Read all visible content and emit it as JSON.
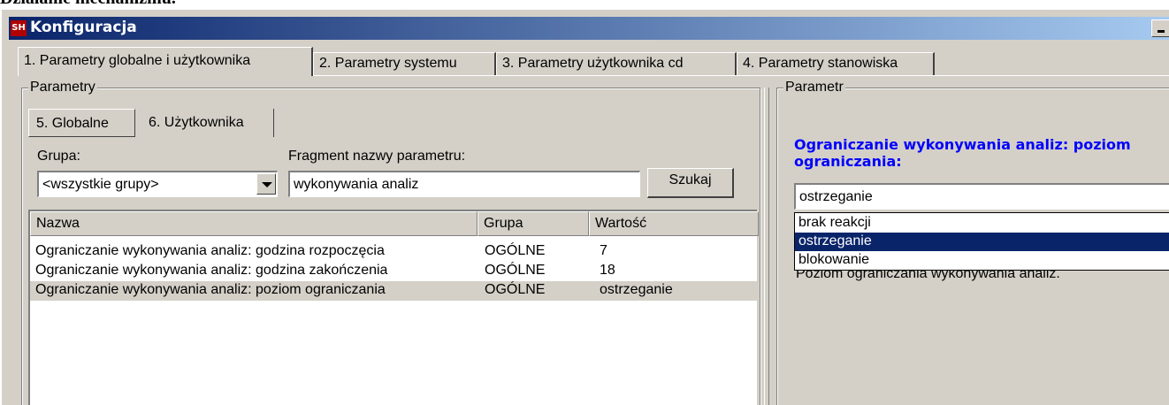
{
  "document": {
    "heading": "Działanie mechanizmu."
  },
  "window": {
    "title": "Konfiguracja",
    "icon_text": "SH"
  },
  "tabs": [
    {
      "label": "1. Parametry globalne i użytkownika"
    },
    {
      "label": "2. Parametry systemu"
    },
    {
      "label": "3. Parametry użytkownika cd"
    },
    {
      "label": "4. Parametry stanowiska"
    }
  ],
  "left_panel": {
    "group_label": "Parametry",
    "subtabs": [
      {
        "label": "5. Globalne"
      },
      {
        "label": "6. Użytkownika"
      }
    ],
    "group_field_label": "Grupa:",
    "group_value": "<wszystkie grupy>",
    "fragment_label": "Fragment nazwy parametru:",
    "fragment_value": "wykonywania analiz",
    "search_button": "Szukaj",
    "table": {
      "columns": [
        "Nazwa",
        "Grupa",
        "Wartość"
      ],
      "rows": [
        {
          "name": "Ograniczanie wykonywania analiz: godzina rozpoczęcia",
          "group": "OGÓLNE",
          "value": "7"
        },
        {
          "name": "Ograniczanie wykonywania analiz: godzina zakończenia",
          "group": "OGÓLNE",
          "value": "18"
        },
        {
          "name": "Ograniczanie wykonywania analiz: poziom ograniczania",
          "group": "OGÓLNE",
          "value": "ostrzeganie"
        }
      ],
      "selected_row": 2
    }
  },
  "right_panel": {
    "group_label": "Parametr",
    "param_title_line1": "Ograniczanie wykonywania analiz: poziom",
    "param_title_line2": "ograniczania:",
    "combo_value": "ostrzeganie",
    "options": [
      "brak reakcji",
      "ostrzeganie",
      "blokowanie"
    ],
    "highlighted_option": "ostrzeganie",
    "description": "Poziom ograniczania wykonywania analiz."
  }
}
